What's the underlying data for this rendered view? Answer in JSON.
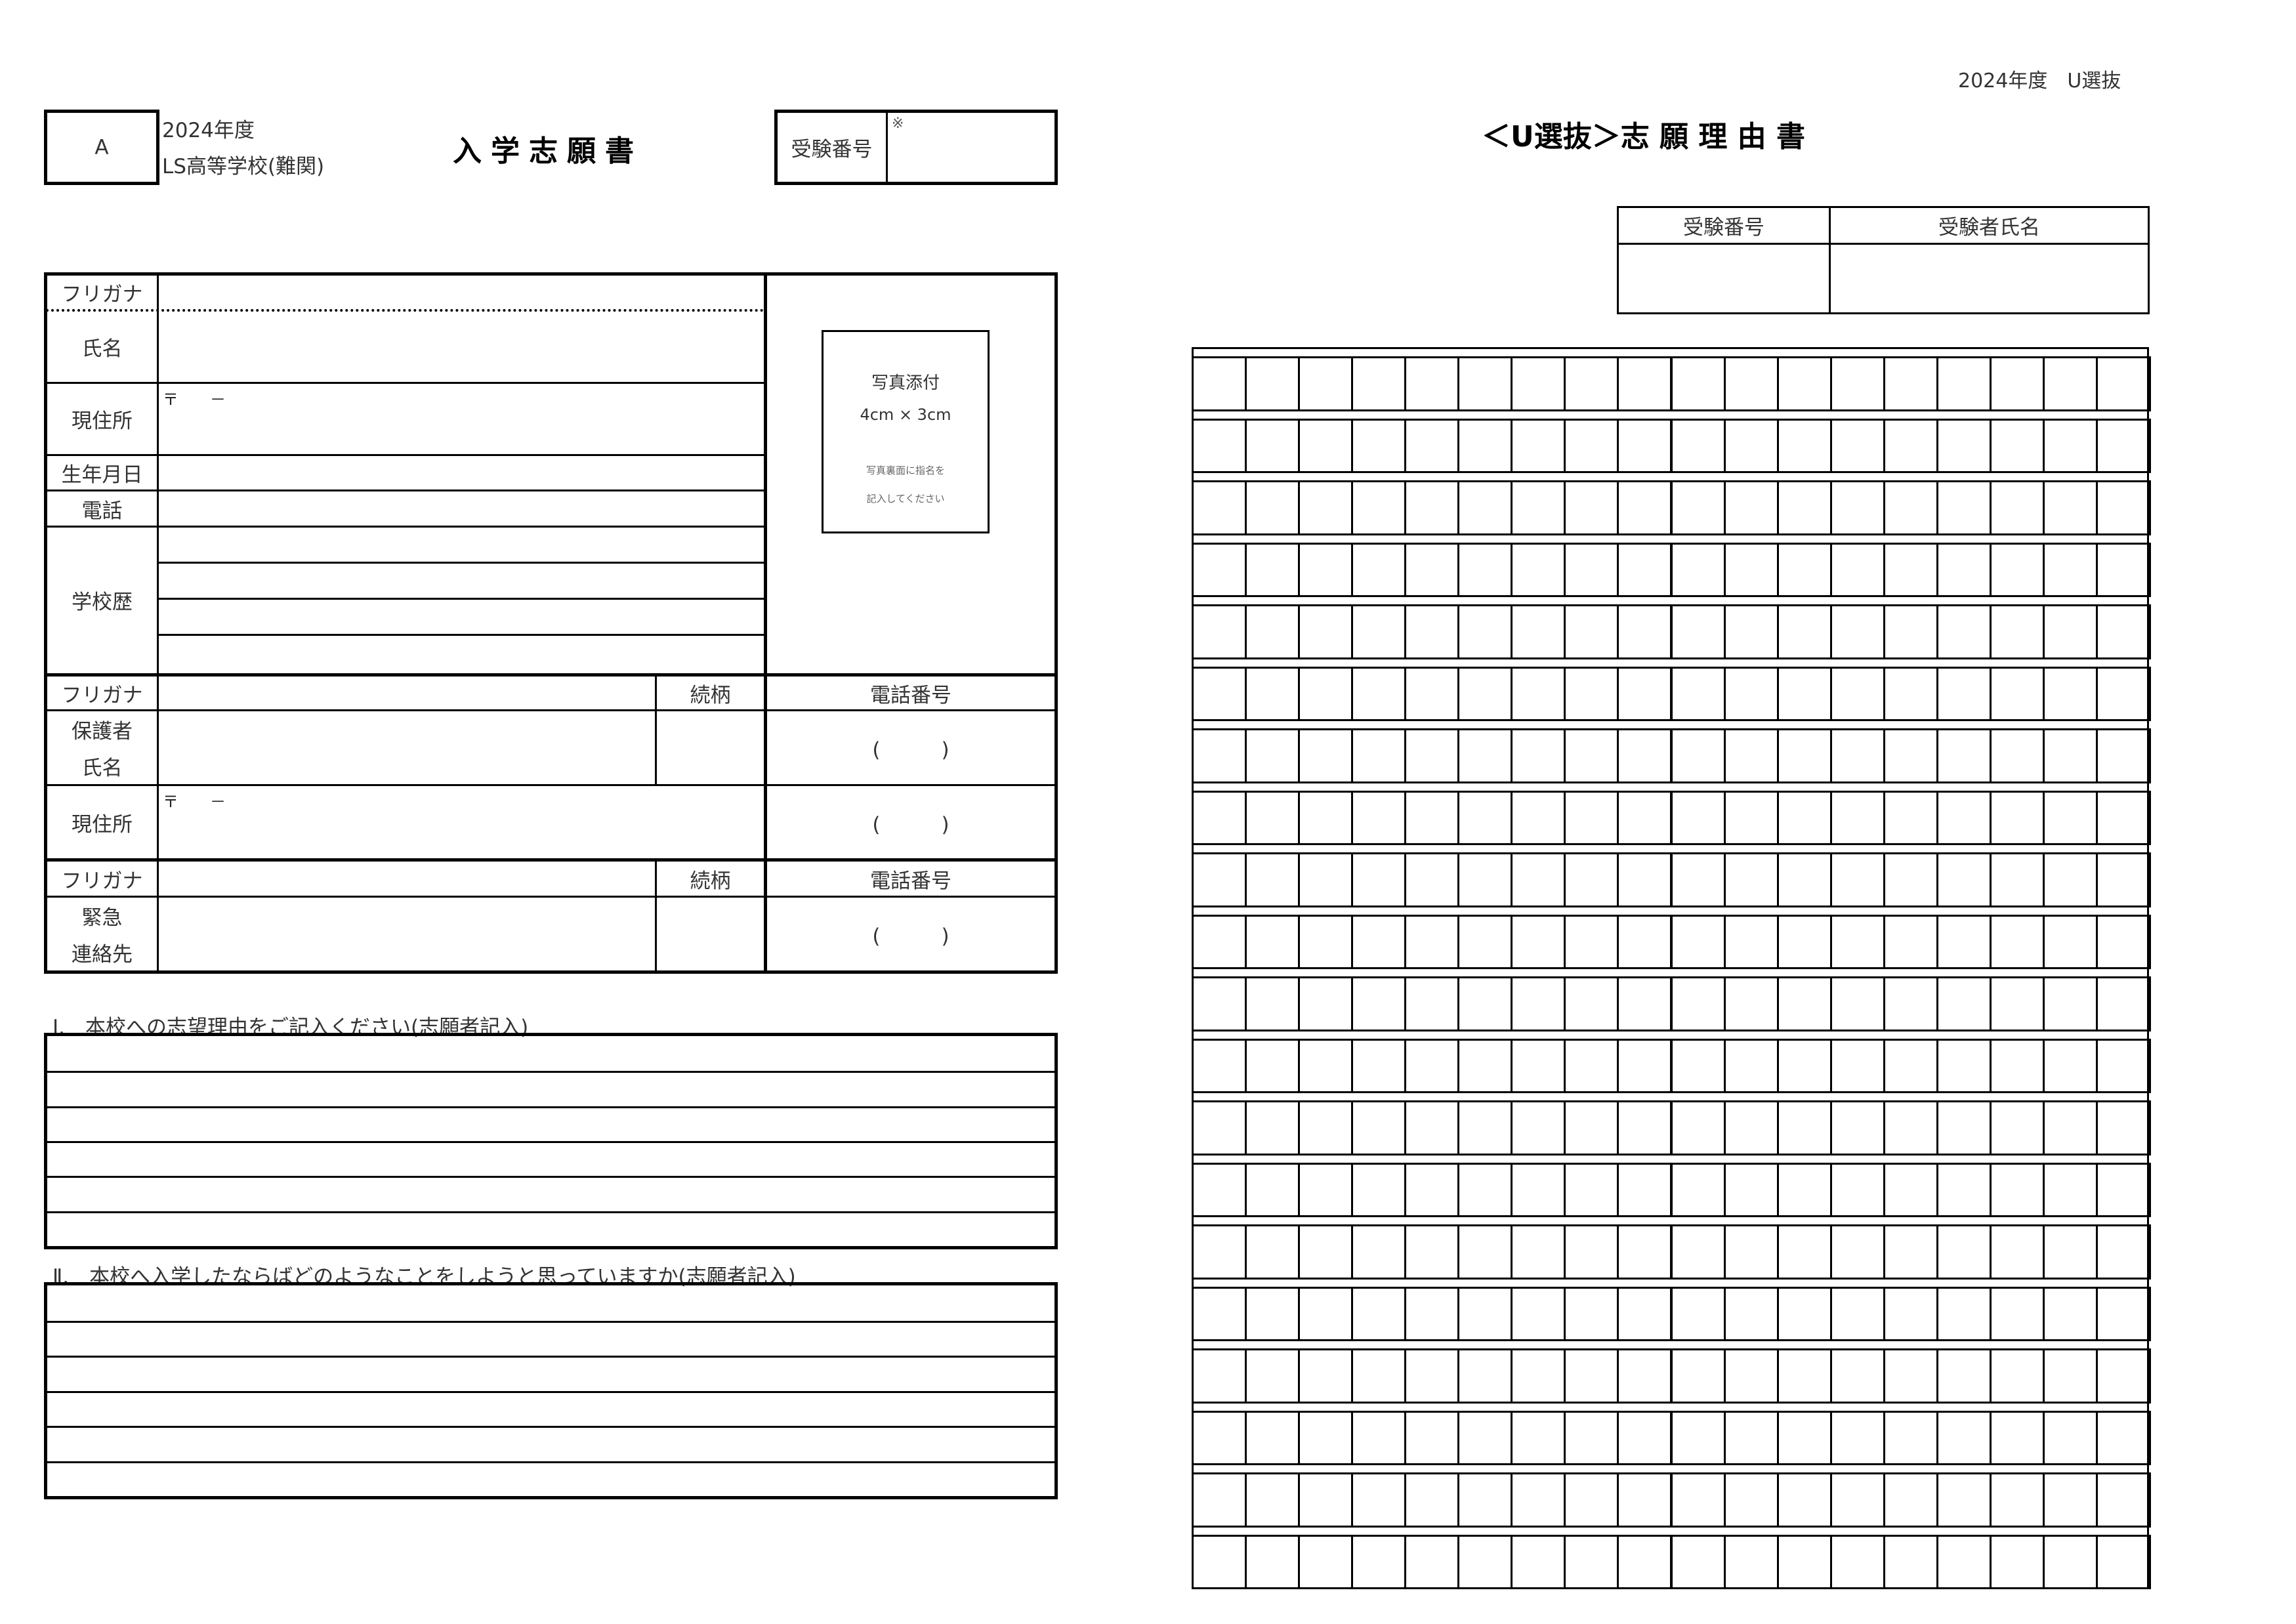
{
  "left_form": {
    "type_box": "A",
    "year_line": "2024年度",
    "school_line": "LS高等学校(難関)",
    "title": "入学志願書",
    "exam_number_label": "受験番号",
    "exam_number_note": "※",
    "applicant": {
      "furigana_label": "フリガナ",
      "name_label": "氏名",
      "address_label": "現住所",
      "postal_prefix": "〒　　－",
      "birthdate_label": "生年月日",
      "phone_label": "電話",
      "school_history_label": "学校歴"
    },
    "photo": {
      "line1": "写真添付",
      "line2": "4cm × 3cm",
      "note1": "写真裏面に指名を",
      "note2": "記入してください"
    },
    "guardian": {
      "furigana_label": "フリガナ",
      "relation_label": "続柄",
      "phone_number_label": "電話番号",
      "name_label_1": "保護者",
      "name_label_2": "氏名",
      "phone_placeholder": "(　　　)",
      "address_label": "現住所",
      "postal_prefix": "〒　　－",
      "address_phone_placeholder": "(　　　)"
    },
    "emergency": {
      "furigana_label": "フリガナ",
      "relation_label": "続柄",
      "phone_number_label": "電話番号",
      "label_1": "緊急",
      "label_2": "連絡先",
      "phone_placeholder": "(　　　)"
    },
    "question_1": "Ⅰ.　本校への志望理由をご記入ください(志願者記入)",
    "question_2": "Ⅱ.　本校へ入学したならばどのようなことをしようと思っていますか(志願者記入)",
    "answer_lines_per_question": 6
  },
  "right_form": {
    "header_note": "2024年度　U選抜",
    "title": "＜U選抜＞志 願 理 由 書",
    "exam_number_label": "受験番号",
    "candidate_name_label": "受験者氏名",
    "manuscript_grid": {
      "columns": 18,
      "rows": 20
    }
  }
}
